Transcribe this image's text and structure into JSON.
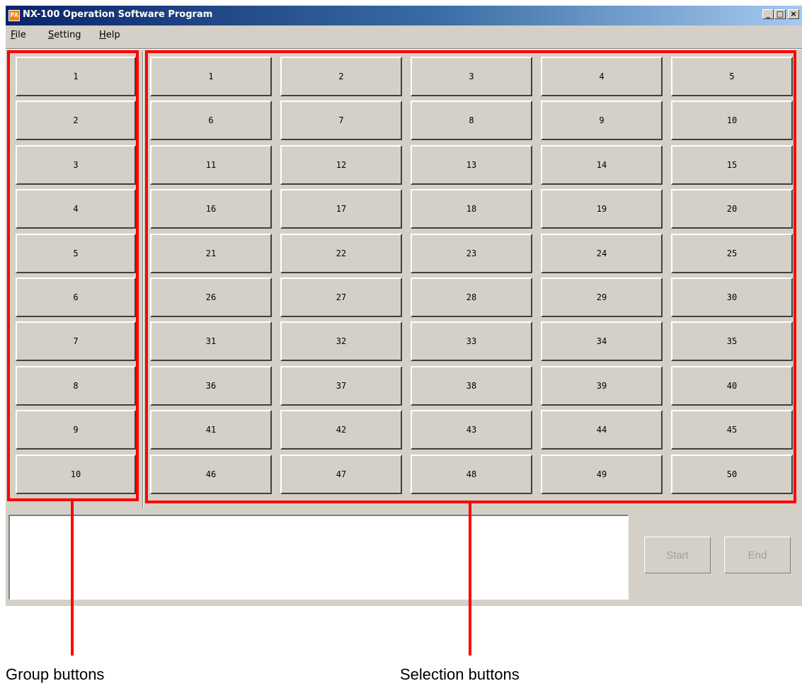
{
  "window": {
    "title": "NX-100 Operation Software Program",
    "icon_text": "PA",
    "controls": {
      "minimize": "_",
      "maximize": "□",
      "close": "×"
    }
  },
  "menu": [
    {
      "mnemonic": "F",
      "rest": "ile"
    },
    {
      "mnemonic": "S",
      "rest": "etting"
    },
    {
      "mnemonic": "H",
      "rest": "elp"
    }
  ],
  "group_buttons": [
    "1",
    "2",
    "3",
    "4",
    "5",
    "6",
    "7",
    "8",
    "9",
    "10"
  ],
  "selection_buttons": [
    "1",
    "2",
    "3",
    "4",
    "5",
    "6",
    "7",
    "8",
    "9",
    "10",
    "11",
    "12",
    "13",
    "14",
    "15",
    "16",
    "17",
    "18",
    "19",
    "20",
    "21",
    "22",
    "23",
    "24",
    "25",
    "26",
    "27",
    "28",
    "29",
    "30",
    "31",
    "32",
    "33",
    "34",
    "35",
    "36",
    "37",
    "38",
    "39",
    "40",
    "41",
    "42",
    "43",
    "44",
    "45",
    "46",
    "47",
    "48",
    "49",
    "50"
  ],
  "actions": {
    "start": "Start",
    "end": "End"
  },
  "captions": {
    "group": "Group buttons",
    "selection": "Selection buttons"
  },
  "colors": {
    "highlight": "#ff0000",
    "face": "#d4d0c8",
    "title_start": "#0a246a"
  }
}
